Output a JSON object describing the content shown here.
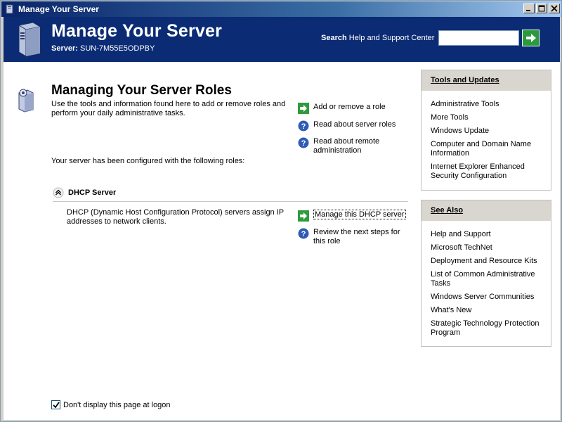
{
  "window": {
    "title": "Manage Your Server",
    "buttons": [
      "minimize",
      "maximize",
      "close"
    ]
  },
  "header": {
    "title": "Manage Your Server",
    "server_label": "Server:",
    "server_name": "SUN-7M55E5ODPBY",
    "search_label_bold": "Search",
    "search_label_rest": "Help and Support Center",
    "search_value": ""
  },
  "main": {
    "title": "Managing Your Server Roles",
    "intro": "Use the tools and information found here to add or remove roles and perform your daily administrative tasks.",
    "configured_text": "Your server has been configured with the following roles:",
    "tasks": [
      {
        "label": "Add or remove a role",
        "icon": "green-arrow-icon"
      },
      {
        "label": "Read about server roles",
        "icon": "help-icon"
      },
      {
        "label": "Read about remote administration",
        "icon": "help-icon"
      }
    ],
    "role": {
      "name": "DHCP Server",
      "description": "DHCP (Dynamic Host Configuration Protocol) servers assign IP addresses to network clients.",
      "tasks": [
        {
          "label": "Manage this DHCP server",
          "icon": "green-arrow-icon"
        },
        {
          "label": "Review the next steps for this role",
          "icon": "help-icon"
        }
      ]
    },
    "dont_display_label": "Don't display this page at logon",
    "dont_display_checked": true
  },
  "sidebar": {
    "tools": {
      "title": "Tools and Updates",
      "items": [
        "Administrative Tools",
        "More Tools",
        "Windows Update",
        "Computer and Domain Name Information",
        "Internet Explorer Enhanced Security Configuration"
      ]
    },
    "see_also": {
      "title": "See Also",
      "items": [
        "Help and Support",
        "Microsoft TechNet",
        "Deployment and Resource Kits",
        "List of Common Administrative Tasks",
        "Windows Server Communities",
        "What's New",
        "Strategic Technology Protection Program"
      ]
    }
  },
  "colors": {
    "banner": "#0b2b74",
    "titlebar_start": "#0a246a",
    "go_button": "#2b9a3c"
  }
}
